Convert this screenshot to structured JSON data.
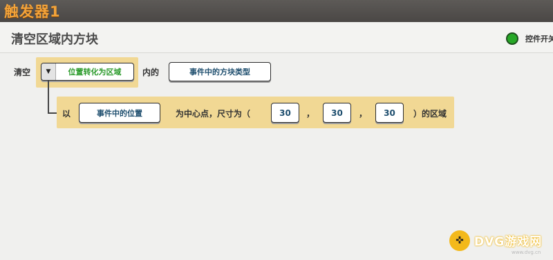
{
  "window": {
    "title": "触发器1"
  },
  "header": {
    "title": "清空区域内方块",
    "switch_label": "控件开关",
    "switch_color": "#27a827"
  },
  "row1": {
    "prefix": "清空",
    "dropdown_label": "位置转化为区域",
    "middle": "内的",
    "block_type_button": "事件中的方块类型"
  },
  "row2": {
    "prefix": "以",
    "position_button": "事件中的位置",
    "center_text": "为中心点，尺寸为（",
    "size_x": "30",
    "size_y": "30",
    "size_z": "30",
    "sep1": "，",
    "sep2": "，",
    "suffix": "）的区域"
  },
  "watermark": {
    "brand": "DVG游戏网",
    "url": "www.dvg.cn",
    "logo_icon": "gamepad-icon"
  },
  "colors": {
    "highlight": "#f1d894",
    "title_orange": "#f2a33a",
    "dropdown_text": "#2a9a2a"
  }
}
